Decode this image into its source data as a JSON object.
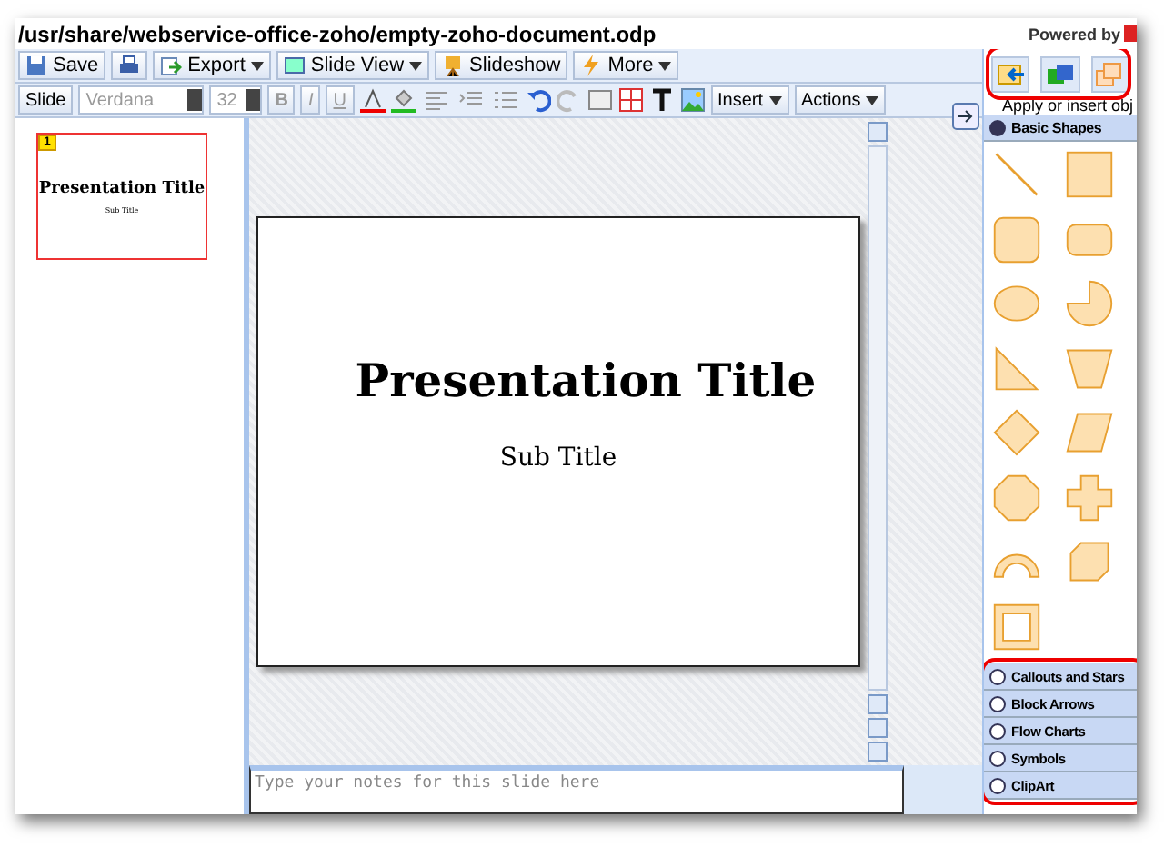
{
  "window": {
    "title": "/usr/share/webservice-office-zoho/empty-zoho-document.odp",
    "powered_by": "Powered by"
  },
  "toolbar": [
    {
      "kind": "save",
      "label": "Save"
    },
    {
      "kind": "print"
    },
    {
      "kind": "export",
      "label": "Export",
      "dropdown": true
    },
    {
      "kind": "view",
      "label": "Slide View",
      "dropdown": true
    },
    {
      "kind": "slideshow",
      "label": "Slideshow"
    },
    {
      "kind": "more",
      "label": "More",
      "dropdown": true
    }
  ],
  "format_bar": {
    "slide_button": "Slide",
    "font": "Verdana",
    "size": "32",
    "bold": "B",
    "italic": "I",
    "underline": "U",
    "insert": "Insert",
    "actions": "Actions"
  },
  "slides": [
    {
      "number": "1",
      "title": "Presentation Title",
      "subtitle": "Sub Title",
      "selected": true
    }
  ],
  "slide": {
    "title": "Presentation Title",
    "subtitle": "Sub Title"
  },
  "notes": {
    "placeholder": "Type your notes for this slide here"
  },
  "panel": {
    "tabs": [
      {
        "kind": "apply"
      },
      {
        "kind": "layout"
      },
      {
        "kind": "objects"
      }
    ],
    "hint": "Apply or insert obj",
    "sections": [
      {
        "label": "Basic Shapes",
        "expanded": true
      },
      {
        "label": "Callouts and Stars",
        "expanded": false
      },
      {
        "label": "Block Arrows",
        "expanded": false
      },
      {
        "label": "Flow Charts",
        "expanded": false
      },
      {
        "label": "Symbols",
        "expanded": false
      },
      {
        "label": "ClipArt",
        "expanded": false
      }
    ]
  }
}
